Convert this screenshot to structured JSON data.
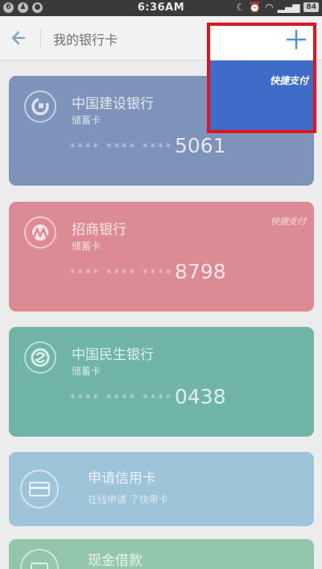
{
  "status_bar": {
    "time": "6:36AM",
    "battery": "84"
  },
  "header": {
    "title": "我的银行卡"
  },
  "cards": [
    {
      "bank": "中国建设银行",
      "type": "储蓄卡",
      "mask": "**** **** ****",
      "last4": "5061",
      "color": "#7e93b9"
    },
    {
      "bank": "招商银行",
      "type": "储蓄卡",
      "mask": "**** **** ****",
      "last4": "8798",
      "badge": "快捷支付",
      "color": "#dc8b95"
    },
    {
      "bank": "中国民生银行",
      "type": "储蓄卡",
      "mask": "**** **** ****",
      "last4": "0438",
      "color": "#6fb4a7"
    }
  ],
  "apply": {
    "title": "申请信用卡",
    "subtitle": "在线申请 了快审卡"
  },
  "loan": {
    "title": "现金借款"
  },
  "popup": {
    "badge": "快捷支付"
  }
}
